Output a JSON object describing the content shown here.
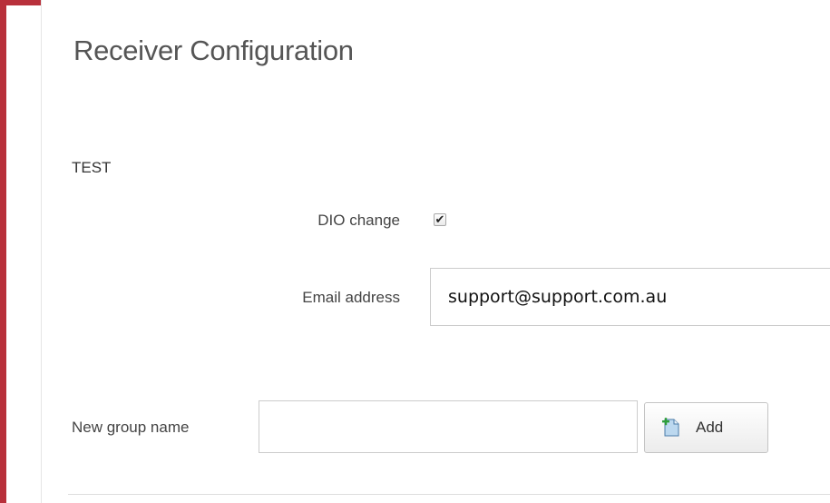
{
  "header": {
    "title": "Receiver Configuration"
  },
  "group": {
    "name": "TEST",
    "dio_change": {
      "label": "DIO change",
      "checked": true,
      "check_glyph": "✔"
    },
    "email": {
      "label": "Email address",
      "value": "support@support.com.au"
    }
  },
  "new_group": {
    "label": "New group name",
    "value": "",
    "add_button_label": "Add",
    "add_icon": "add-document-icon"
  },
  "colors": {
    "frame_accent": "#b8303b",
    "title_text": "#555555",
    "input_border": "#cccccc"
  }
}
